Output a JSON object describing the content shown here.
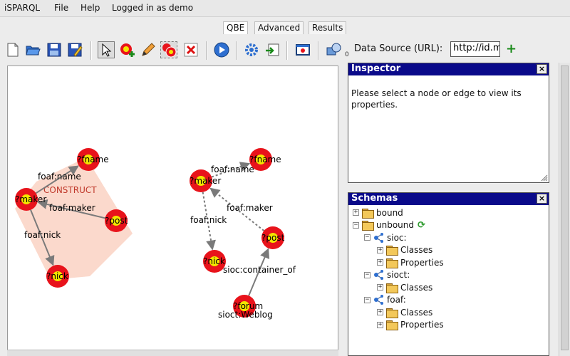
{
  "menu": {
    "app": "iSPARQL",
    "file": "File",
    "help": "Help",
    "user": "Logged in as demo"
  },
  "tabs": [
    {
      "label": "QBE",
      "active": true
    },
    {
      "label": "Advanced",
      "active": false
    },
    {
      "label": "Results",
      "active": false
    }
  ],
  "toolbar": {
    "buttons": [
      "new-file-icon",
      "open-folder-icon",
      "save-icon",
      "save-as-icon",
      "pointer-icon",
      "add-node-icon",
      "pencil-icon",
      "group-icon",
      "delete-icon",
      "run-icon",
      "settings-icon",
      "import-icon",
      "window-icon",
      "connection-icon"
    ],
    "connection_count": "0",
    "datasource_label": "Data Source (URL):",
    "datasource_value": "http://id.myopenlink.net/dataspace",
    "add_symbol": "+"
  },
  "graph": {
    "construct_label": "CONSTRUCT",
    "nodes": [
      {
        "id": "n1",
        "label": "?fname"
      },
      {
        "id": "n2",
        "label": "?maker"
      },
      {
        "id": "n3",
        "label": "?post"
      },
      {
        "id": "n4",
        "label": "?nick"
      },
      {
        "id": "n5",
        "label": "?fname"
      },
      {
        "id": "n6",
        "label": "?maker"
      },
      {
        "id": "n7",
        "label": "?nick"
      },
      {
        "id": "n8",
        "label": "?post"
      },
      {
        "id": "n9",
        "label": "?forum"
      }
    ],
    "edges": [
      {
        "from": "n2",
        "to": "n1",
        "label": "foaf:name",
        "dashed": false
      },
      {
        "from": "n3",
        "to": "n2",
        "label": "foaf:maker",
        "dashed": false
      },
      {
        "from": "n2",
        "to": "n4",
        "label": "foaf:nick",
        "dashed": false
      },
      {
        "from": "n6",
        "to": "n5",
        "label": "foaf:name",
        "dashed": true
      },
      {
        "from": "n8",
        "to": "n6",
        "label": "foaf:maker",
        "dashed": true
      },
      {
        "from": "n6",
        "to": "n7",
        "label": "foaf:nick",
        "dashed": true
      },
      {
        "from": "n9",
        "to": "n8",
        "label": "sioc:container_of",
        "dashed": false
      }
    ],
    "type_label": "sioct:Weblog"
  },
  "inspector": {
    "title": "Inspector",
    "close": "×",
    "message": "Please select a node or edge to view its properties."
  },
  "schemas": {
    "title": "Schemas",
    "close": "×",
    "tree": [
      {
        "label": "bound",
        "exp": "+",
        "icon": "folder",
        "depth": 0
      },
      {
        "label": "unbound",
        "exp": "−",
        "icon": "folder",
        "depth": 0,
        "refresh": true
      },
      {
        "label": "sioc:",
        "exp": "−",
        "icon": "ns",
        "depth": 1
      },
      {
        "label": "Classes",
        "exp": "+",
        "icon": "folder",
        "depth": 2
      },
      {
        "label": "Properties",
        "exp": "+",
        "icon": "folder",
        "depth": 2
      },
      {
        "label": "sioct:",
        "exp": "−",
        "icon": "ns",
        "depth": 1
      },
      {
        "label": "Classes",
        "exp": "+",
        "icon": "folder",
        "depth": 2
      },
      {
        "label": "foaf:",
        "exp": "−",
        "icon": "ns",
        "depth": 1
      },
      {
        "label": "Classes",
        "exp": "+",
        "icon": "folder",
        "depth": 2
      },
      {
        "label": "Properties",
        "exp": "+",
        "icon": "folder",
        "depth": 2
      }
    ]
  },
  "colors": {
    "panel_header": "#0a0a8a",
    "node_outer": "#e8131b",
    "node_inner": "#f3e600",
    "construct_fill": "#fbd9cc",
    "construct_text": "#c0392b"
  }
}
